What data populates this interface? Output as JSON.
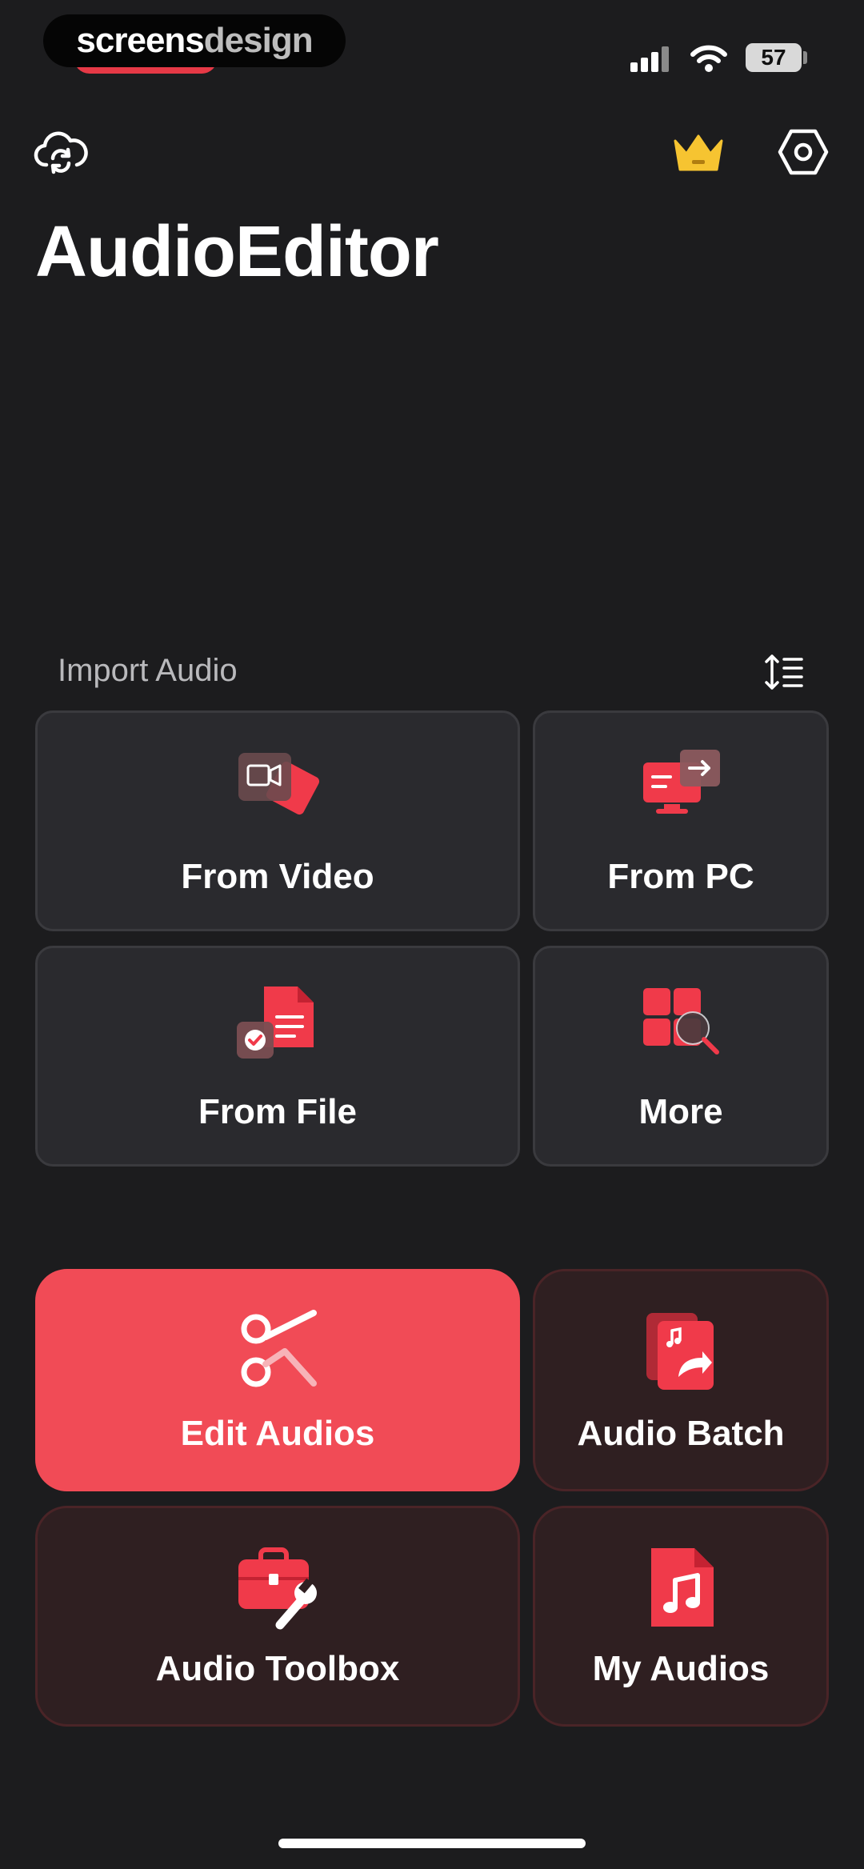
{
  "status_bar": {
    "watermark_part1": "screens",
    "watermark_part2": "design",
    "battery": "57"
  },
  "header": {
    "app_title": "AudioEditor",
    "icons": [
      "cloud-sync-icon",
      "crown-icon",
      "settings-icon"
    ]
  },
  "import_section": {
    "label": "Import Audio",
    "sort_icon": "sort-icon",
    "tiles": [
      {
        "label": "From Video",
        "icon": "video-icon"
      },
      {
        "label": "From PC",
        "icon": "pc-transfer-icon"
      },
      {
        "label": "From File",
        "icon": "file-icon"
      },
      {
        "label": "More",
        "icon": "more-grid-icon"
      }
    ]
  },
  "actions": [
    {
      "label": "Edit Audios",
      "icon": "scissors-icon"
    },
    {
      "label": "Audio Batch",
      "icon": "audio-batch-icon"
    },
    {
      "label": "Audio Toolbox",
      "icon": "toolbox-icon"
    },
    {
      "label": "My Audios",
      "icon": "music-file-icon"
    }
  ],
  "colors": {
    "background": "#1c1c1e",
    "accent": "#f14b56",
    "tile": "#2a2a2e",
    "action_tile": "#2f1f21",
    "crown": "#f6c431"
  }
}
